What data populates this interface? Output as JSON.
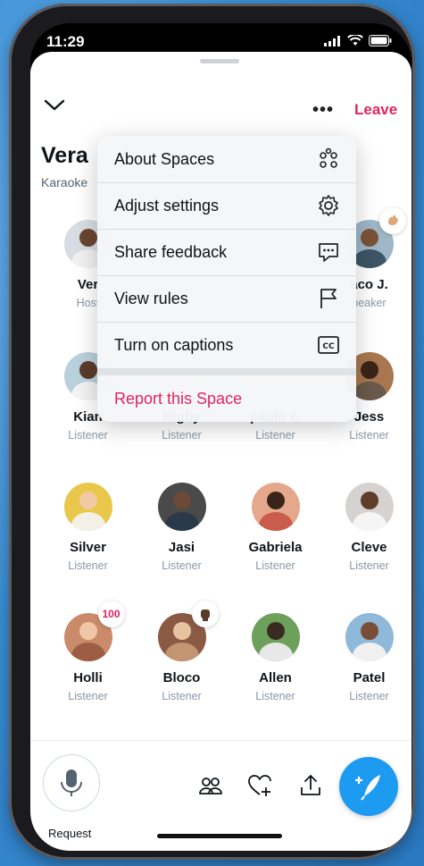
{
  "status_bar": {
    "time": "11:29"
  },
  "header": {
    "leave_label": "Leave",
    "more_label": "•••"
  },
  "space": {
    "title": "Vera",
    "subtitle": "Karaoke"
  },
  "participants": [
    {
      "name": "Ver",
      "role": "Host",
      "reaction": ""
    },
    {
      "name": "",
      "role": "",
      "reaction": ""
    },
    {
      "name": "",
      "role": "",
      "reaction": ""
    },
    {
      "name": "aco J.",
      "role": "peaker",
      "reaction": "wave"
    },
    {
      "name": "Kian",
      "role": "Listener",
      "reaction": ""
    },
    {
      "name": "Rigby",
      "role": "Listener",
      "reaction": ""
    },
    {
      "name": "paulo c.",
      "role": "Listener",
      "reaction": ""
    },
    {
      "name": "Jess",
      "role": "Listener",
      "reaction": ""
    },
    {
      "name": "Silver",
      "role": "Listener",
      "reaction": ""
    },
    {
      "name": "Jasi",
      "role": "Listener",
      "reaction": ""
    },
    {
      "name": "Gabriela",
      "role": "Listener",
      "reaction": ""
    },
    {
      "name": "Cleve",
      "role": "Listener",
      "reaction": ""
    },
    {
      "name": "Holli",
      "role": "Listener",
      "reaction": "100"
    },
    {
      "name": "Bloco",
      "role": "Listener",
      "reaction": "fist"
    },
    {
      "name": "Allen",
      "role": "Listener",
      "reaction": ""
    },
    {
      "name": "Patel",
      "role": "Listener",
      "reaction": ""
    }
  ],
  "menu": {
    "items": [
      {
        "label": "About Spaces",
        "icon": "spaces-dots-icon"
      },
      {
        "label": "Adjust settings",
        "icon": "gear-icon"
      },
      {
        "label": "Share feedback",
        "icon": "feedback-icon"
      },
      {
        "label": "View rules",
        "icon": "flag-icon"
      },
      {
        "label": "Turn on captions",
        "icon": "captions-icon"
      }
    ],
    "report_label": "Report this Space"
  },
  "bottom_bar": {
    "request_label": "Request"
  },
  "colors": {
    "accent": "#1d9bf0",
    "danger": "#e0245e"
  }
}
